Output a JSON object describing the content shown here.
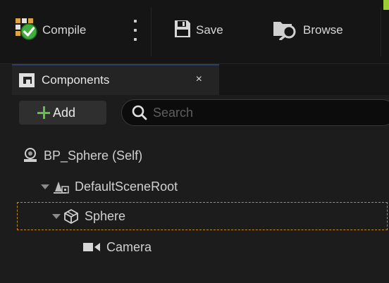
{
  "toolbar": {
    "compile_label": "Compile",
    "save_label": "Save",
    "browse_label": "Browse"
  },
  "panel": {
    "tab_label": "Components",
    "tab_close": "×",
    "add_label": "Add",
    "search_placeholder": "Search"
  },
  "tree": {
    "self": "BP_Sphere (Self)",
    "root": "DefaultSceneRoot",
    "sphere": "Sphere",
    "camera": "Camera"
  },
  "colors": {
    "accent_green": "#60c04a",
    "selection_outline": "#c98a1c",
    "tab_accent": "#2c3f66"
  }
}
